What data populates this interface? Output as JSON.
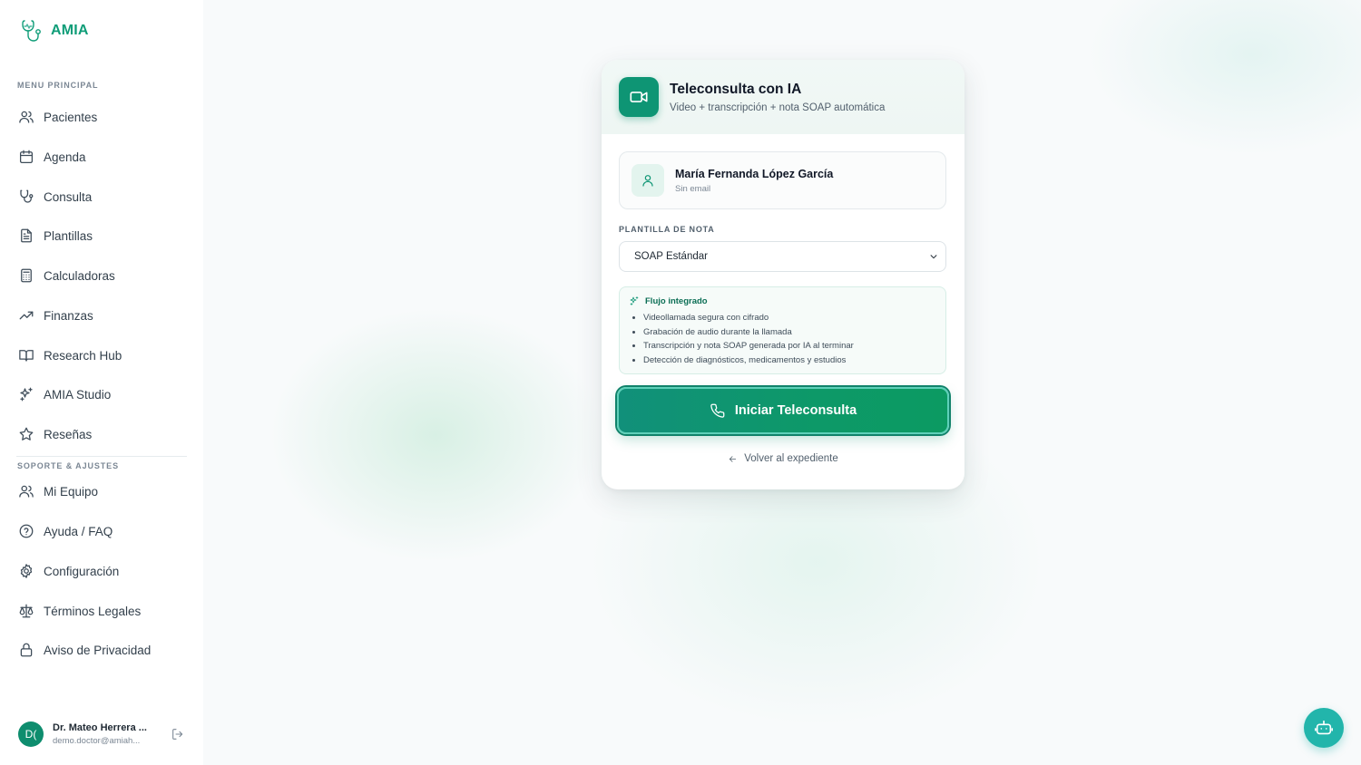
{
  "brand": {
    "name": "AMIA",
    "logo_icon": "stethoscope-heart-icon",
    "accent": "#0f9d78"
  },
  "sidebar": {
    "section_main": "MENU PRINCIPAL",
    "main_items": [
      {
        "label": "Pacientes",
        "icon": "users-icon"
      },
      {
        "label": "Agenda",
        "icon": "calendar-icon"
      },
      {
        "label": "Consulta",
        "icon": "stethoscope-icon"
      },
      {
        "label": "Plantillas",
        "icon": "document-icon"
      },
      {
        "label": "Calculadoras",
        "icon": "calculator-icon"
      },
      {
        "label": "Finanzas",
        "icon": "trending-up-icon"
      },
      {
        "label": "Research Hub",
        "icon": "book-open-icon"
      },
      {
        "label": "AMIA Studio",
        "icon": "sparkles-icon"
      },
      {
        "label": "Reseñas",
        "icon": "star-icon"
      }
    ],
    "section_support": "SOPORTE & AJUSTES",
    "support_items": [
      {
        "label": "Mi Equipo",
        "icon": "users-icon"
      },
      {
        "label": "Ayuda / FAQ",
        "icon": "help-circle-icon"
      },
      {
        "label": "Configuración",
        "icon": "gear-icon"
      },
      {
        "label": "Términos Legales",
        "icon": "scale-icon"
      },
      {
        "label": "Aviso de Privacidad",
        "icon": "lock-icon"
      }
    ],
    "user": {
      "initials": "D(",
      "name": "Dr. Mateo Herrera ...",
      "email": "demo.doctor@amiah...",
      "logout_icon": "logout-icon"
    }
  },
  "card": {
    "title": "Teleconsulta con IA",
    "subtitle": "Video + transcripción + nota SOAP automática",
    "header_icon": "video-camera-icon",
    "patient": {
      "name": "María Fernanda López García",
      "email": "Sin email",
      "icon": "user-icon"
    },
    "template_label": "PLANTILLA DE NOTA",
    "template_selected": "SOAP Estándar",
    "flow": {
      "title": "Flujo integrado",
      "icon": "sparkles-icon",
      "items": [
        "Videollamada segura con cifrado",
        "Grabación de audio durante la llamada",
        "Transcripción y nota SOAP generada por IA al terminar",
        "Detección de diagnósticos, medicamentos y estudios"
      ]
    },
    "start_button": "Iniciar Teleconsulta",
    "start_icon": "phone-icon",
    "back_link": "Volver al expediente",
    "back_icon": "arrow-left-icon"
  },
  "assistant_button_icon": "robot-icon"
}
